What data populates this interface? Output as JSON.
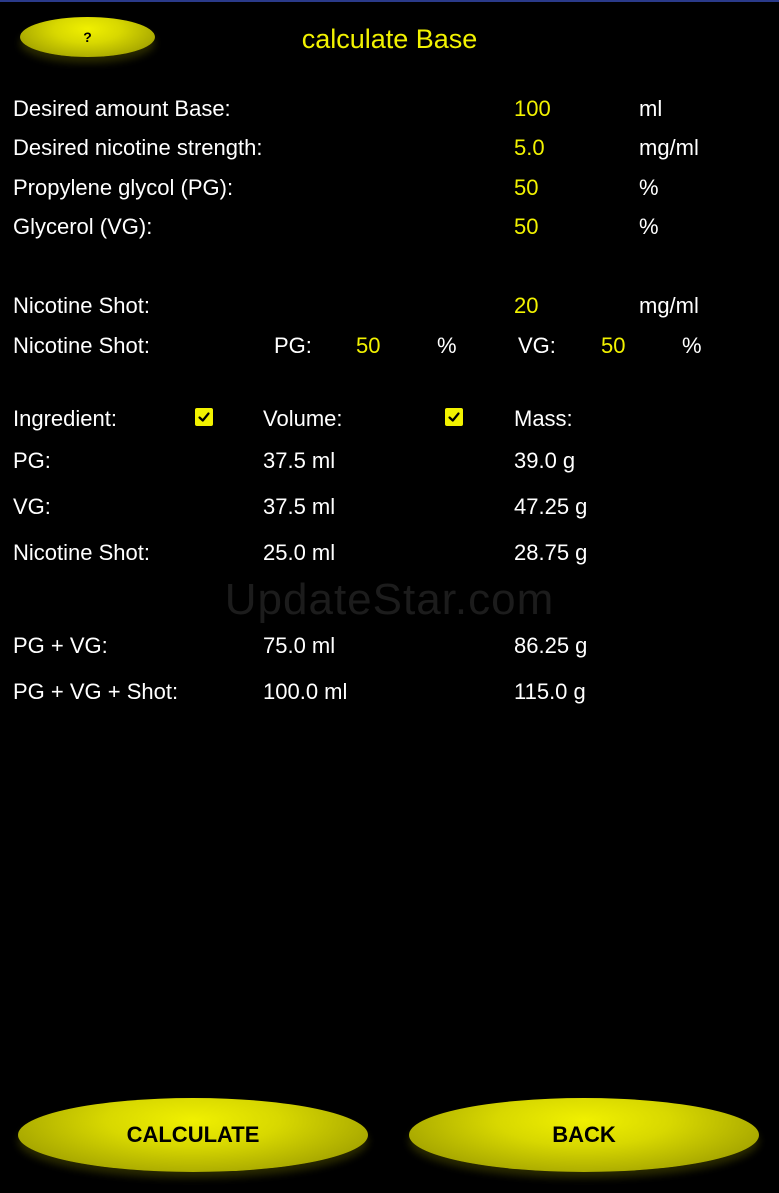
{
  "header": {
    "help_label": "?",
    "title": "calculate Base"
  },
  "inputs": {
    "amount": {
      "label": "Desired amount Base:",
      "value": "100",
      "unit": "ml"
    },
    "nicotine": {
      "label": "Desired nicotine strength:",
      "value": "5.0",
      "unit": "mg/ml"
    },
    "pg": {
      "label": "Propylene glycol (PG):",
      "value": "50",
      "unit": "%"
    },
    "vg": {
      "label": "Glycerol (VG):",
      "value": "50",
      "unit": "%"
    },
    "shot": {
      "label": "Nicotine Shot:",
      "value": "20",
      "unit": "mg/ml"
    },
    "shot_ratio": {
      "label": "Nicotine Shot:",
      "pg_label": "PG:",
      "pg_value": "50",
      "pg_unit": "%",
      "vg_label": "VG:",
      "vg_value": "50",
      "vg_unit": "%"
    }
  },
  "results": {
    "headers": {
      "ingredient": "Ingredient:",
      "volume": "Volume:",
      "mass": "Mass:"
    },
    "checkboxes": {
      "volume_checked": true,
      "mass_checked": true
    },
    "rows": [
      {
        "name": "PG:",
        "volume": "37.5 ml",
        "mass": "39.0 g"
      },
      {
        "name": "VG:",
        "volume": "37.5 ml",
        "mass": "47.25 g"
      },
      {
        "name": "Nicotine Shot:",
        "volume": "25.0 ml",
        "mass": "28.75 g"
      }
    ],
    "totals": [
      {
        "name": "PG + VG:",
        "volume": "75.0 ml",
        "mass": "86.25 g"
      },
      {
        "name": "PG + VG + Shot:",
        "volume": "100.0 ml",
        "mass": "115.0 g"
      }
    ]
  },
  "watermark": "UpdateStar.com",
  "footer": {
    "calculate_label": "CALCULATE",
    "back_label": "BACK"
  },
  "colors": {
    "background": "#000000",
    "accent": "#f2f200",
    "text": "#ffffff"
  }
}
